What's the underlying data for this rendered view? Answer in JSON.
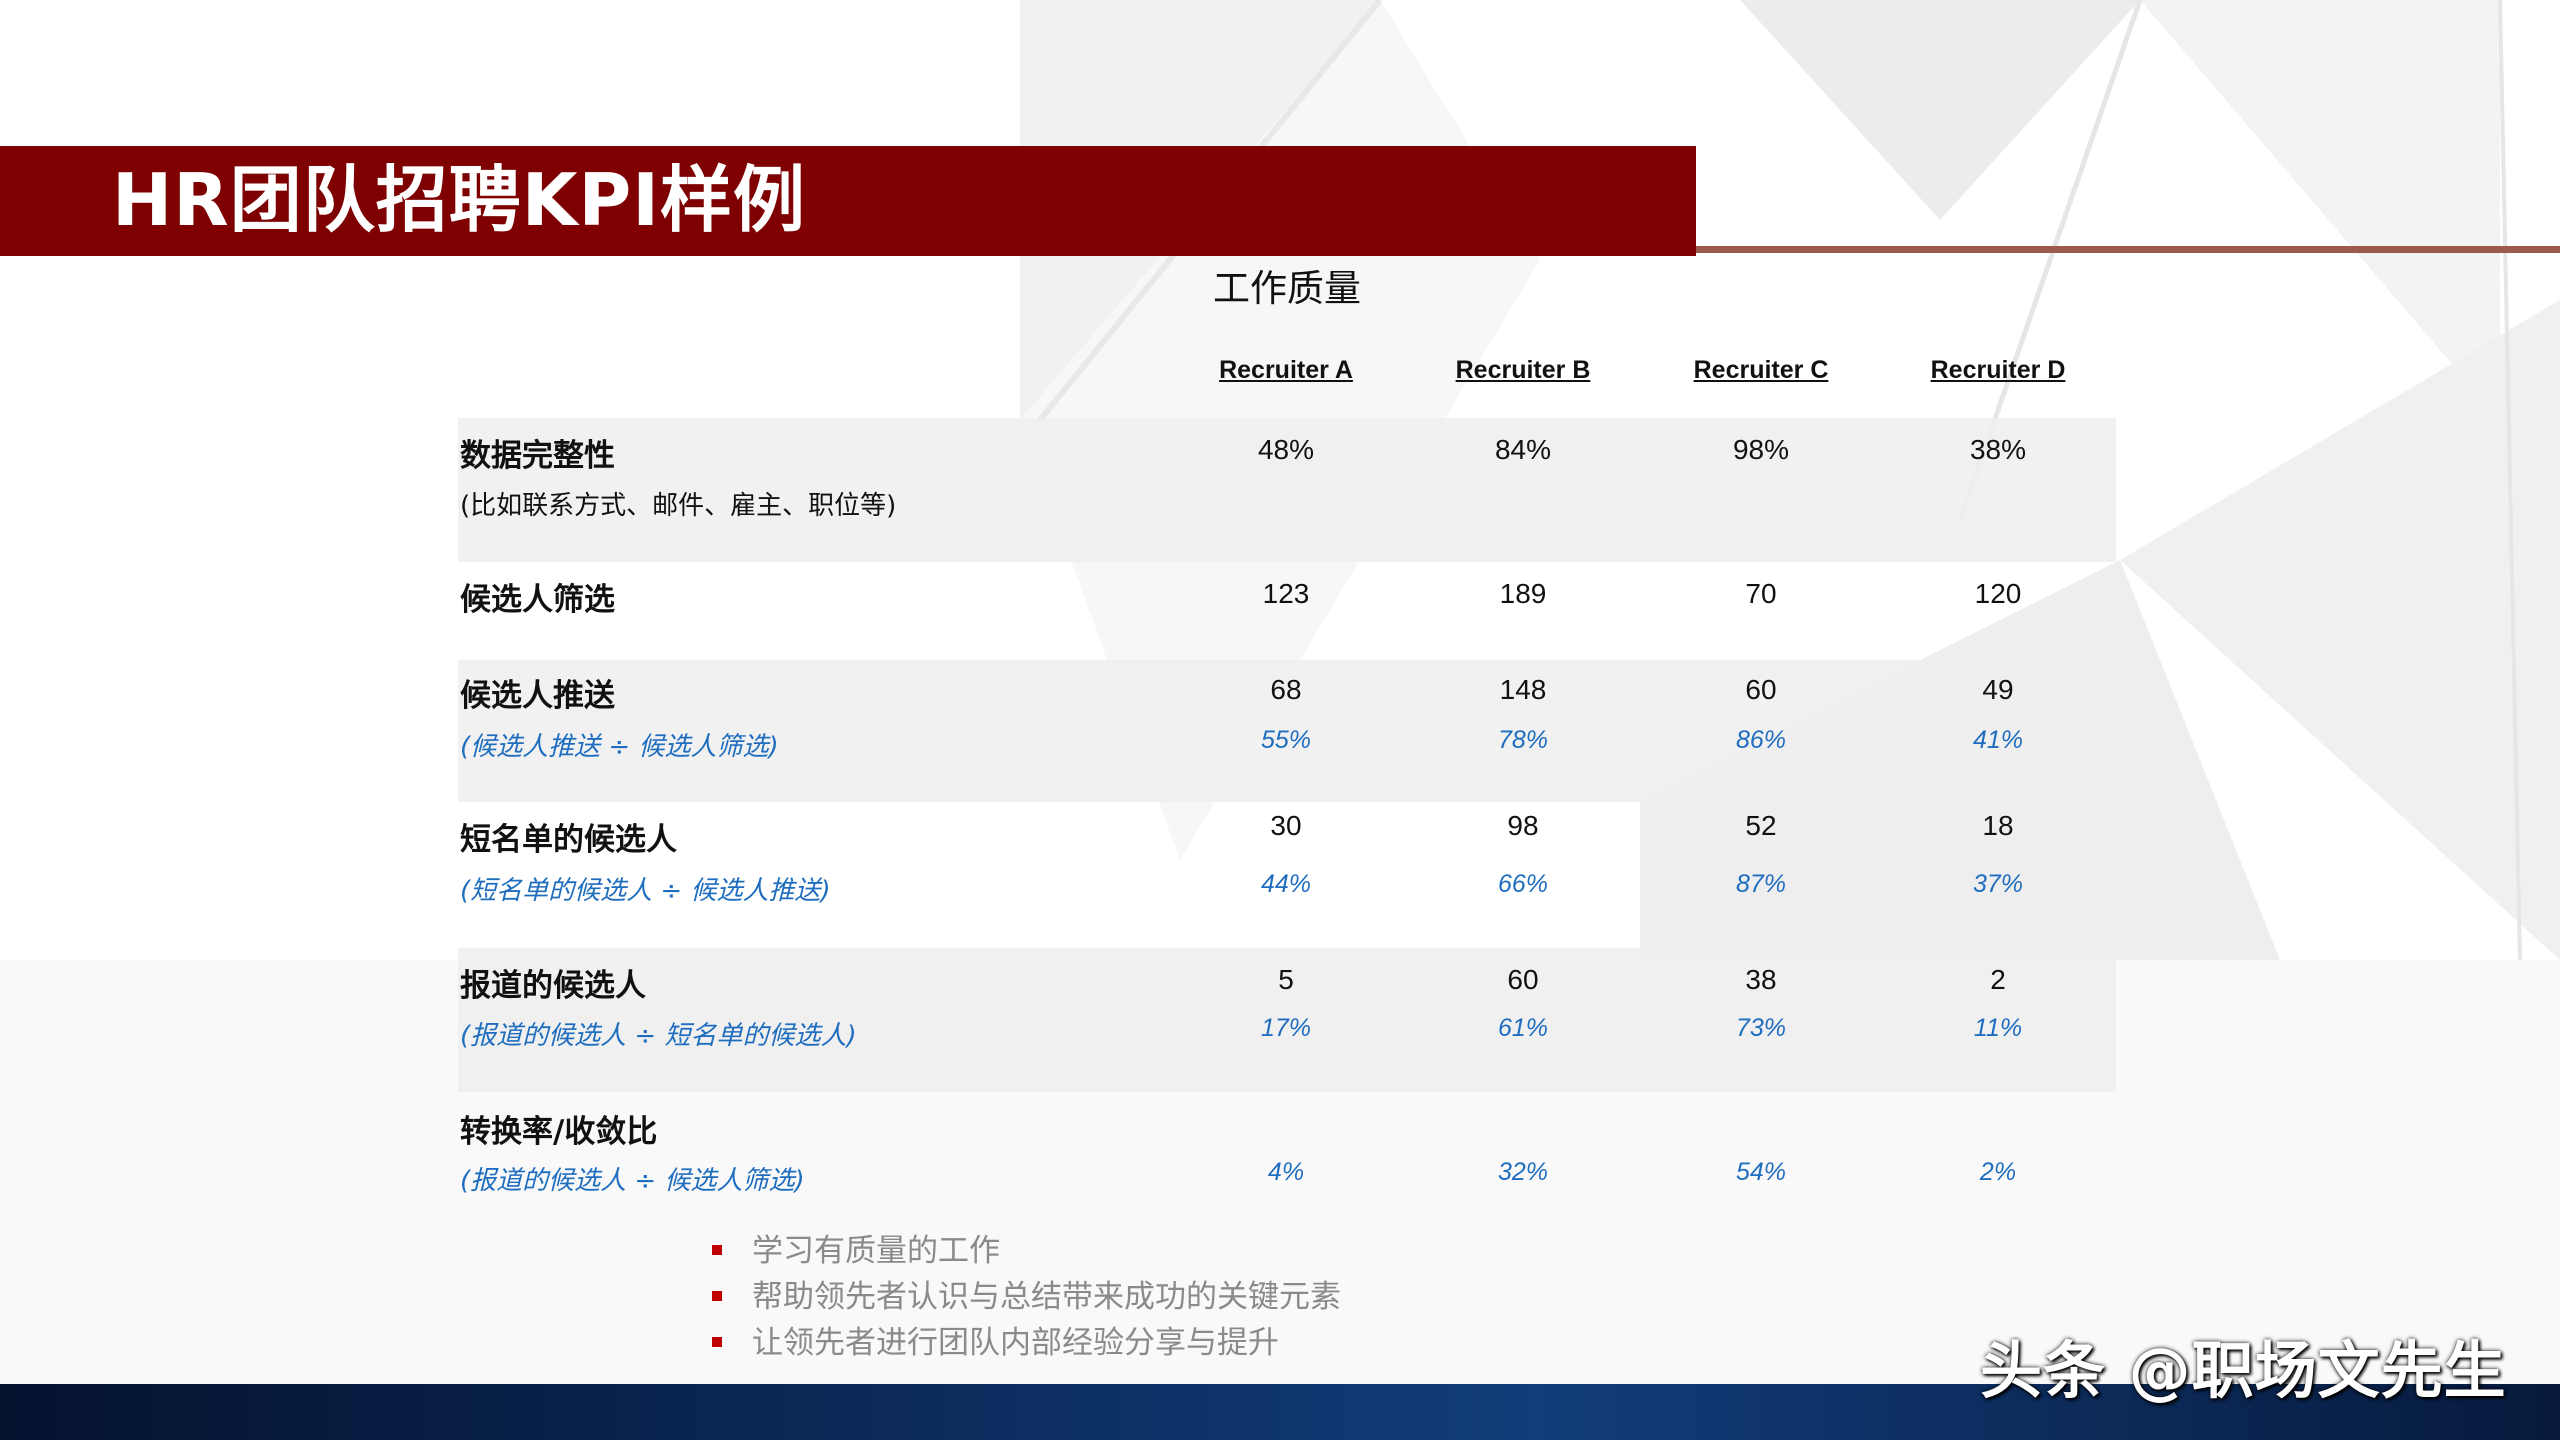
{
  "title": "HR团队招聘KPI样例",
  "section_heading": "工作质量",
  "columns": [
    "Recruiter A",
    "Recruiter B",
    "Recruiter C",
    "Recruiter D"
  ],
  "rows": [
    {
      "label": "数据完整性",
      "sub": "(比如联系方式、邮件、雇主、职位等)",
      "values": [
        "48%",
        "84%",
        "98%",
        "38%"
      ]
    },
    {
      "label": "候选人筛选",
      "values": [
        "123",
        "189",
        "70",
        "120"
      ]
    },
    {
      "label": "候选人推送",
      "sub": "(候选人推送 ÷ 候选人筛选)",
      "values": [
        "68",
        "148",
        "60",
        "49"
      ],
      "pcts": [
        "55%",
        "78%",
        "86%",
        "41%"
      ]
    },
    {
      "label": "短名单的候选人",
      "sub": "(短名单的候选人 ÷ 候选人推送)",
      "values": [
        "30",
        "98",
        "52",
        "18"
      ],
      "pcts": [
        "44%",
        "66%",
        "87%",
        "37%"
      ]
    },
    {
      "label": "报道的候选人",
      "sub": "(报道的候选人 ÷ 短名单的候选人)",
      "values": [
        "5",
        "60",
        "38",
        "2"
      ],
      "pcts": [
        "17%",
        "61%",
        "73%",
        "11%"
      ]
    },
    {
      "label": "转换率/收敛比",
      "sub": "(报道的候选人 ÷ 候选人筛选)",
      "pcts": [
        "4%",
        "32%",
        "54%",
        "2%"
      ]
    }
  ],
  "bullets": [
    "学习有质量的工作",
    "帮助领先者认识与总结带来成功的关键元素",
    "让领先者进行团队内部经验分享与提升"
  ],
  "watermark": "头条 @职场文先生",
  "colors": {
    "title_bar": "#7e0000",
    "accent_blue": "#1f6dbf",
    "bullet": "#c00000"
  }
}
